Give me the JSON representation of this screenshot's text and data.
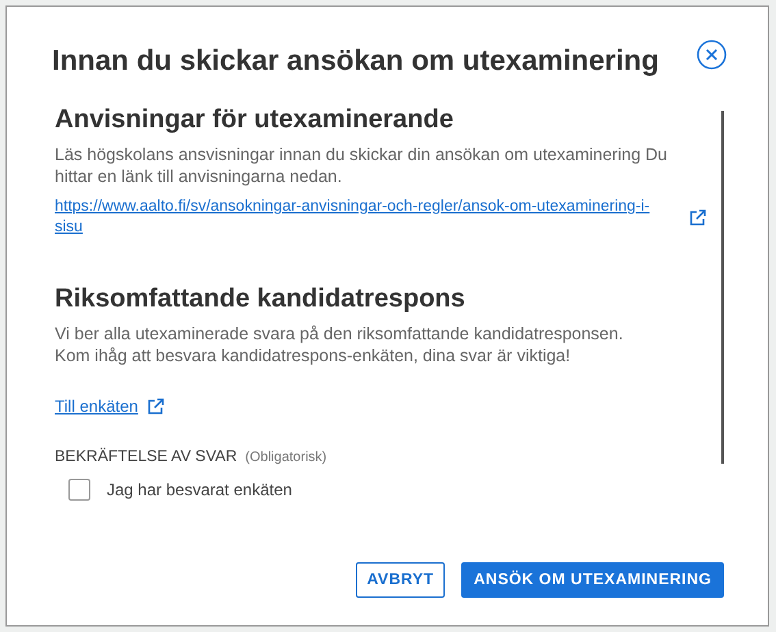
{
  "dialog": {
    "title": "Innan du skickar ansökan om utexaminering"
  },
  "sections": [
    {
      "heading": "Anvisningar för utexaminerande",
      "text": "Läs högskolans ansvisningar innan du skickar din ansökan om utexaminering Du hittar en länk till anvisningarna nedan.",
      "link": "https://www.aalto.fi/sv/ansokningar-anvisningar-och-regler/ansok-om-utexaminering-i-sisu",
      "kind": "block"
    },
    {
      "heading": "Riksomfattande kandidatrespons",
      "text": "Vi ber alla utexaminerade svara på den riksomfattande kandidatresponsen.\nKom ihåg att besvara kandidatrespons-enkäten, dina svar är viktiga!",
      "link": "Till enkäten",
      "kind": "inline"
    }
  ],
  "confirmation": {
    "label": "BEKRÄFTELSE AV SVAR",
    "note": "(Obligatorisk)",
    "checkbox": {
      "label": "Jag har besvarat enkäten",
      "checked": false
    }
  },
  "buttons": [
    {
      "label": "AVBRYT",
      "kind": "secondary"
    },
    {
      "label": "ANSÖK OM UTEXAMINERING",
      "kind": "primary"
    }
  ]
}
